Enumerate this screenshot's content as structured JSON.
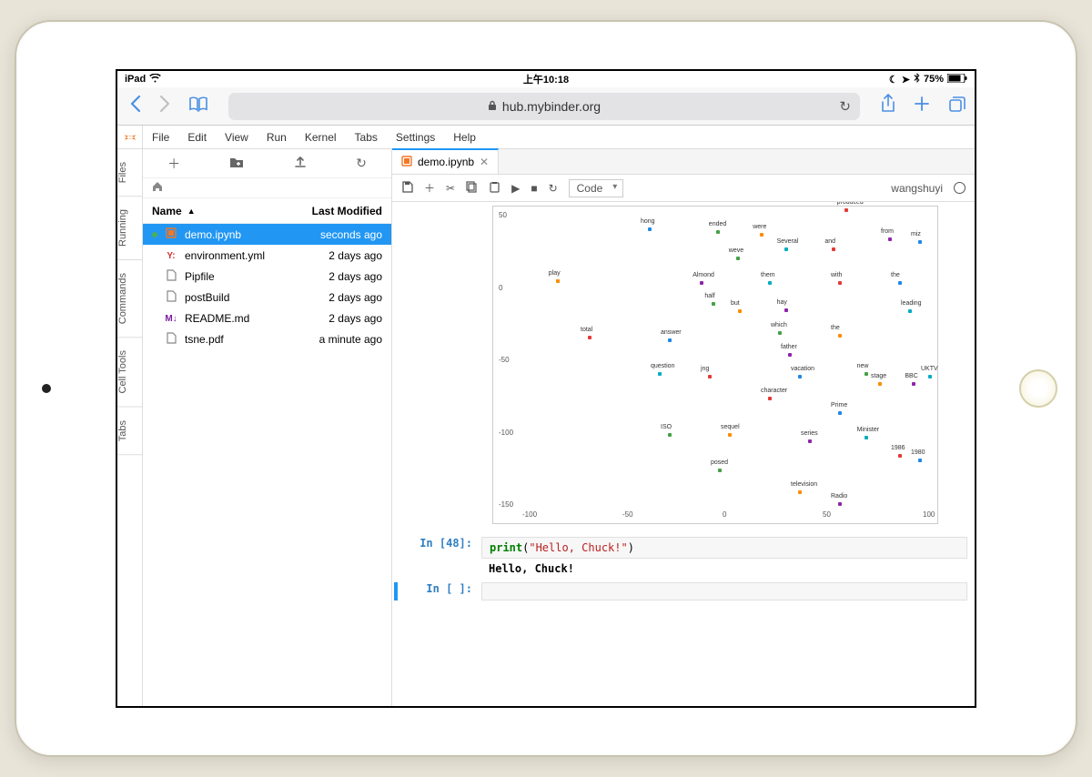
{
  "statusbar": {
    "device": "iPad",
    "time": "上午10:18",
    "battery": "75%"
  },
  "safari": {
    "url_host": "hub.mybinder.org"
  },
  "menu": {
    "file": "File",
    "edit": "Edit",
    "view": "View",
    "run": "Run",
    "kernel": "Kernel",
    "tabs": "Tabs",
    "settings": "Settings",
    "help": "Help"
  },
  "left_tabs": {
    "files": "Files",
    "running": "Running",
    "commands": "Commands",
    "celltools": "Cell Tools",
    "tabs": "Tabs"
  },
  "filebrowser": {
    "header_name": "Name",
    "header_modified": "Last Modified",
    "rows": [
      {
        "name": "demo.ipynb",
        "modified": "seconds ago",
        "icon": "notebook",
        "selected": true,
        "running": true
      },
      {
        "name": "environment.yml",
        "modified": "2 days ago",
        "icon": "yaml"
      },
      {
        "name": "Pipfile",
        "modified": "2 days ago",
        "icon": "file"
      },
      {
        "name": "postBuild",
        "modified": "2 days ago",
        "icon": "file"
      },
      {
        "name": "README.md",
        "modified": "2 days ago",
        "icon": "markdown"
      },
      {
        "name": "tsne.pdf",
        "modified": "a minute ago",
        "icon": "file"
      }
    ]
  },
  "tab": {
    "title": "demo.ipynb"
  },
  "nb_toolbar": {
    "celltype": "Code"
  },
  "kernel_user": "wangshuyi",
  "cells": {
    "c48_prompt_label": "In [48]:",
    "c48_kw": "print",
    "c48_paren_open": "(",
    "c48_str": "\"Hello, Chuck!\"",
    "c48_paren_close": ")",
    "c48_output": "Hello, Chuck!",
    "empty_prompt_label": "In [ ]:"
  },
  "chart_data": {
    "type": "scatter",
    "title": "",
    "xlabel": "",
    "ylabel": "",
    "xlim": [
      -100,
      100
    ],
    "ylim": [
      -150,
      50
    ],
    "xticks": [
      -100,
      -50,
      0,
      50,
      100
    ],
    "yticks": [
      -150,
      -100,
      -50,
      0,
      50
    ],
    "points": [
      {
        "label": "produced",
        "x": 58,
        "y": 55
      },
      {
        "label": "hong",
        "x": -40,
        "y": 42
      },
      {
        "label": "ended",
        "x": -6,
        "y": 40
      },
      {
        "label": "were",
        "x": 16,
        "y": 38
      },
      {
        "label": "from",
        "x": 80,
        "y": 35
      },
      {
        "label": "Several",
        "x": 28,
        "y": 28
      },
      {
        "label": "and",
        "x": 52,
        "y": 28
      },
      {
        "label": "miz",
        "x": 95,
        "y": 33
      },
      {
        "label": "weve",
        "x": 4,
        "y": 22
      },
      {
        "label": "play",
        "x": -86,
        "y": 6
      },
      {
        "label": "Almond",
        "x": -14,
        "y": 5
      },
      {
        "label": "them",
        "x": 20,
        "y": 5
      },
      {
        "label": "with",
        "x": 55,
        "y": 5
      },
      {
        "label": "the",
        "x": 85,
        "y": 5
      },
      {
        "label": "half",
        "x": -8,
        "y": -10
      },
      {
        "label": "but",
        "x": 5,
        "y": -15
      },
      {
        "label": "hay",
        "x": 28,
        "y": -14
      },
      {
        "label": "leading",
        "x": 90,
        "y": -15
      },
      {
        "label": "total",
        "x": -70,
        "y": -33
      },
      {
        "label": "answer",
        "x": -30,
        "y": -35
      },
      {
        "label": "which",
        "x": 25,
        "y": -30
      },
      {
        "label": "the",
        "x": 55,
        "y": -32
      },
      {
        "label": "father",
        "x": 30,
        "y": -45
      },
      {
        "label": "question",
        "x": -35,
        "y": -58
      },
      {
        "label": "jng",
        "x": -10,
        "y": -60
      },
      {
        "label": "vacation",
        "x": 35,
        "y": -60
      },
      {
        "label": "new",
        "x": 68,
        "y": -58
      },
      {
        "label": "stage",
        "x": 75,
        "y": -65
      },
      {
        "label": "BBC",
        "x": 92,
        "y": -65
      },
      {
        "label": "UKTV",
        "x": 100,
        "y": -60
      },
      {
        "label": "character",
        "x": 20,
        "y": -75
      },
      {
        "label": "Prime",
        "x": 55,
        "y": -85
      },
      {
        "label": "ISO",
        "x": -30,
        "y": -100
      },
      {
        "label": "sequel",
        "x": 0,
        "y": -100
      },
      {
        "label": "series",
        "x": 40,
        "y": -105
      },
      {
        "label": "Minister",
        "x": 68,
        "y": -102
      },
      {
        "label": "1986",
        "x": 85,
        "y": -115
      },
      {
        "label": "1980",
        "x": 95,
        "y": -118
      },
      {
        "label": "posed",
        "x": -5,
        "y": -125
      },
      {
        "label": "television",
        "x": 35,
        "y": -140
      },
      {
        "label": "Radio",
        "x": 55,
        "y": -148
      }
    ]
  }
}
